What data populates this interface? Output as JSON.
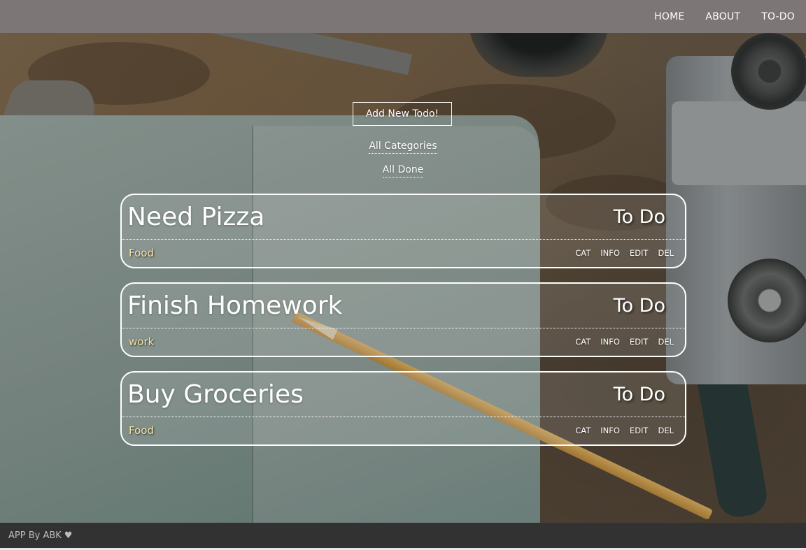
{
  "nav": {
    "links": [
      {
        "label": "HOME"
      },
      {
        "label": "ABOUT"
      },
      {
        "label": "TO-DO"
      }
    ]
  },
  "main": {
    "add_button_label": "Add New Todo!",
    "filters": {
      "all_categories": "All Categories",
      "all_done": "All Done"
    },
    "todos": [
      {
        "title": "Need Pizza",
        "status": "To Do",
        "category": "Food"
      },
      {
        "title": "Finish Homework",
        "status": "To Do",
        "category": "work"
      },
      {
        "title": "Buy Groceries",
        "status": "To Do",
        "category": "Food"
      }
    ],
    "actions": {
      "cat": "CAT",
      "info": "INFO",
      "edit": "EDIT",
      "del": "DEL"
    }
  },
  "footer": {
    "credit": "APP By ABK",
    "heart_glyph": "♥"
  },
  "colors": {
    "navbar_bg": "#7c7776",
    "footer_bg": "#333232",
    "category_text": "#f2e3a6"
  }
}
